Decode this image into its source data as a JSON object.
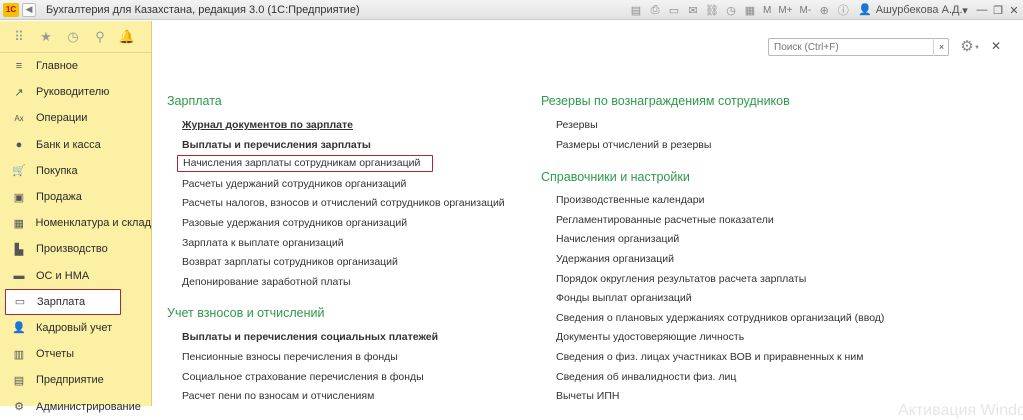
{
  "titlebar": {
    "logo": "1С",
    "title": "Бухгалтерия для Казахстана, редакция 3.0  (1С:Предприятие)",
    "tools_text": [
      "M",
      "M+",
      "M-"
    ],
    "user": "Ашурбекова А.Д."
  },
  "sidebar": {
    "items": [
      {
        "icon": "menu-icon",
        "glyph": "≡",
        "label": "Главное"
      },
      {
        "icon": "chart-icon",
        "glyph": "↗",
        "label": "Руководителю"
      },
      {
        "icon": "operations-icon",
        "glyph": "Ax",
        "label": "Операции"
      },
      {
        "icon": "bank-icon",
        "glyph": "●",
        "label": "Банк и касса"
      },
      {
        "icon": "cart-icon",
        "glyph": "🛒",
        "label": "Покупка"
      },
      {
        "icon": "sale-icon",
        "glyph": "▣",
        "label": "Продажа"
      },
      {
        "icon": "warehouse-icon",
        "glyph": "▦",
        "label": "Номенклатура и склад"
      },
      {
        "icon": "factory-icon",
        "glyph": "▙",
        "label": "Производство"
      },
      {
        "icon": "assets-icon",
        "glyph": "▬",
        "label": "ОС и НМА"
      },
      {
        "icon": "salary-icon",
        "glyph": "▭",
        "label": "Зарплата"
      },
      {
        "icon": "personnel-icon",
        "glyph": "👤",
        "label": "Кадровый учет"
      },
      {
        "icon": "reports-icon",
        "glyph": "▥",
        "label": "Отчеты"
      },
      {
        "icon": "enterprise-icon",
        "glyph": "▤",
        "label": "Предприятие"
      },
      {
        "icon": "admin-icon",
        "glyph": "⚙",
        "label": "Администрирование"
      }
    ]
  },
  "search": {
    "placeholder": "Поиск (Ctrl+F)",
    "clear": "×"
  },
  "left_column": {
    "sections": [
      {
        "title": "Зарплата",
        "links": [
          {
            "label": "Журнал документов по зарплате",
            "bold": true
          },
          {
            "label": "Выплаты и перечисления зарплаты",
            "bold": true
          },
          {
            "label": "Начисления зарплаты сотрудникам организаций",
            "bold": false
          },
          {
            "label": "Расчеты удержаний сотрудников организаций",
            "bold": false
          },
          {
            "label": "Расчеты налогов, взносов и отчислений сотрудников организаций",
            "bold": false
          },
          {
            "label": "Разовые удержания сотрудников организаций",
            "bold": false
          },
          {
            "label": "Зарплата к выплате организаций",
            "bold": false
          },
          {
            "label": "Возврат зарплаты сотрудников организаций",
            "bold": false
          },
          {
            "label": "Депонирование заработной платы",
            "bold": false
          }
        ]
      },
      {
        "title": "Учет взносов и отчислений",
        "links": [
          {
            "label": "Выплаты и перечисления социальных платежей",
            "bold": true
          },
          {
            "label": "Пенсионные взносы перечисления в фонды",
            "bold": false
          },
          {
            "label": "Социальное страхование перечисления в фонды",
            "bold": false
          },
          {
            "label": "Расчет пени по взносам и отчислениям",
            "bold": false
          }
        ]
      }
    ]
  },
  "right_column": {
    "sections": [
      {
        "title": "Резервы по вознаграждениям сотрудников",
        "links": [
          {
            "label": "Резервы"
          },
          {
            "label": "Размеры отчислений в резервы"
          }
        ]
      },
      {
        "title": "Справочники и настройки",
        "links": [
          {
            "label": "Производственные календари"
          },
          {
            "label": "Регламентированные расчетные показатели"
          },
          {
            "label": "Начисления организаций"
          },
          {
            "label": "Удержания организаций"
          },
          {
            "label": "Порядок округления результатов расчета зарплаты"
          },
          {
            "label": "Фонды выплат организаций"
          },
          {
            "label": "Сведения о плановых удержаниях сотрудников организаций (ввод)"
          },
          {
            "label": "Документы удостоверяющие личность"
          },
          {
            "label": "Сведения о физ. лицах участниках ВОВ и приравненных к ним"
          },
          {
            "label": "Сведения об инвалидности физ. лиц"
          },
          {
            "label": "Вычеты ИПН"
          }
        ]
      }
    ]
  },
  "watermark": "Активация Windows"
}
